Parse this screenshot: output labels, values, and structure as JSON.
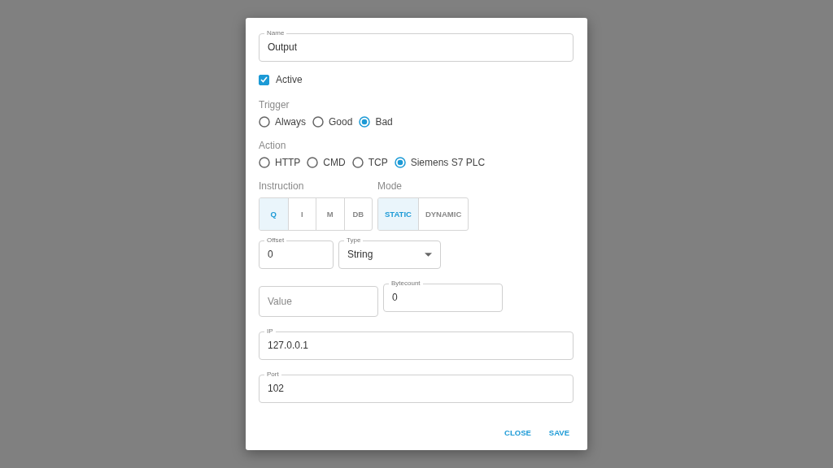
{
  "name_field": {
    "label": "Name",
    "value": "Output"
  },
  "active": {
    "label": "Active",
    "checked": true
  },
  "trigger": {
    "label": "Trigger",
    "options": [
      {
        "label": "Always",
        "selected": false
      },
      {
        "label": "Good",
        "selected": false
      },
      {
        "label": "Bad",
        "selected": true
      }
    ]
  },
  "action": {
    "label": "Action",
    "options": [
      {
        "label": "HTTP",
        "selected": false
      },
      {
        "label": "CMD",
        "selected": false
      },
      {
        "label": "TCP",
        "selected": false
      },
      {
        "label": "Siemens S7 PLC",
        "selected": true
      }
    ]
  },
  "instruction": {
    "label": "Instruction",
    "options": [
      {
        "label": "Q",
        "selected": true
      },
      {
        "label": "I",
        "selected": false
      },
      {
        "label": "M",
        "selected": false
      },
      {
        "label": "DB",
        "selected": false
      }
    ]
  },
  "mode": {
    "label": "Mode",
    "options": [
      {
        "label": "STATIC",
        "selected": true
      },
      {
        "label": "DYNAMIC",
        "selected": false
      }
    ]
  },
  "field_rows": [
    [
      {
        "kind": "text",
        "label": "Offset",
        "value": "0"
      },
      {
        "kind": "select",
        "label": "Type",
        "value": "String"
      }
    ],
    [
      {
        "kind": "text",
        "placeholder": "Value"
      },
      {
        "kind": "text",
        "label": "Bytecount",
        "value": "0"
      }
    ],
    [
      {
        "kind": "text",
        "label": "IP",
        "value": "127.0.0.1"
      }
    ],
    [
      {
        "kind": "text",
        "label": "Port",
        "value": "102"
      }
    ]
  ],
  "buttons": [
    "CLOSE",
    "SAVE"
  ]
}
